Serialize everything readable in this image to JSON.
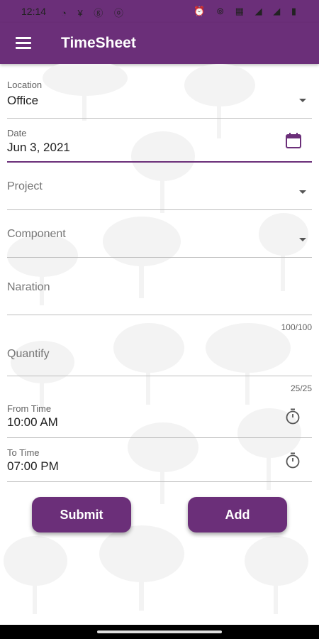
{
  "status_bar": {
    "time": "12:14",
    "left_icons": "◔ ¥ ⓖ ⓞ",
    "right_icons": "⏰ ⊚ ▦ ◢ ◢ ▮"
  },
  "app_bar": {
    "title": "TimeSheet",
    "menu_icon": "menu-icon"
  },
  "form": {
    "location": {
      "label": "Location",
      "value": "Office"
    },
    "date": {
      "label": "Date",
      "value": "Jun 3, 2021",
      "icon": "calendar-icon"
    },
    "project": {
      "placeholder": "Project"
    },
    "component": {
      "placeholder": "Component"
    },
    "naration": {
      "placeholder": "Naration",
      "counter": "100/100"
    },
    "quantify": {
      "placeholder": "Quantify",
      "counter": "25/25"
    },
    "from_time": {
      "label": "From Time",
      "value": "10:00 AM",
      "icon": "stopwatch-icon"
    },
    "to_time": {
      "label": "To Time",
      "value": "07:00 PM",
      "icon": "stopwatch-icon"
    }
  },
  "actions": {
    "submit_label": "Submit",
    "add_label": "Add"
  },
  "colors": {
    "primary": "#6b2f79",
    "divider": "#bdbdbd",
    "background": "#ffffff"
  }
}
